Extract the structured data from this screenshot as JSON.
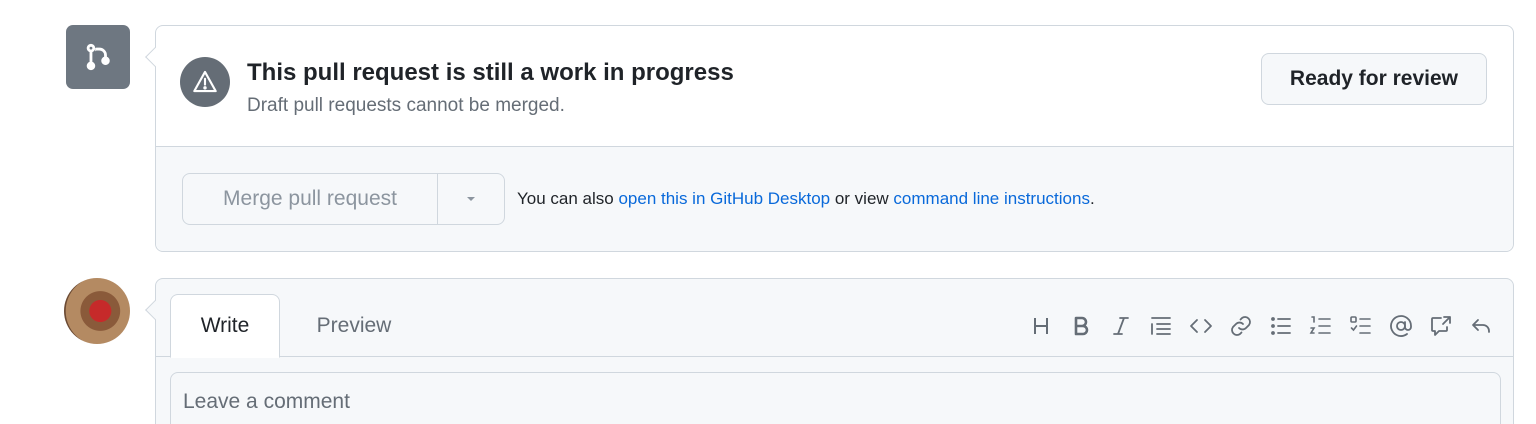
{
  "merge": {
    "title": "This pull request is still a work in progress",
    "subtitle": "Draft pull requests cannot be merged.",
    "ready_button": "Ready for review",
    "merge_button": "Merge pull request",
    "note_prefix": "You can also ",
    "link_desktop": "open this in GitHub Desktop",
    "note_middle": " or view ",
    "link_cli": "command line instructions",
    "note_suffix": "."
  },
  "comment": {
    "tab_write": "Write",
    "tab_preview": "Preview",
    "placeholder": "Leave a comment",
    "toolbar": [
      "heading-icon",
      "bold-icon",
      "italic-icon",
      "quote-icon",
      "code-icon",
      "link-icon",
      "unordered-list-icon",
      "ordered-list-icon",
      "task-list-icon",
      "mention-icon",
      "cross-reference-icon",
      "reply-icon"
    ]
  },
  "colors": {
    "accent_link": "#0969da",
    "border": "#d0d7de",
    "muted": "#656d76",
    "icon_box": "#6e7781"
  }
}
